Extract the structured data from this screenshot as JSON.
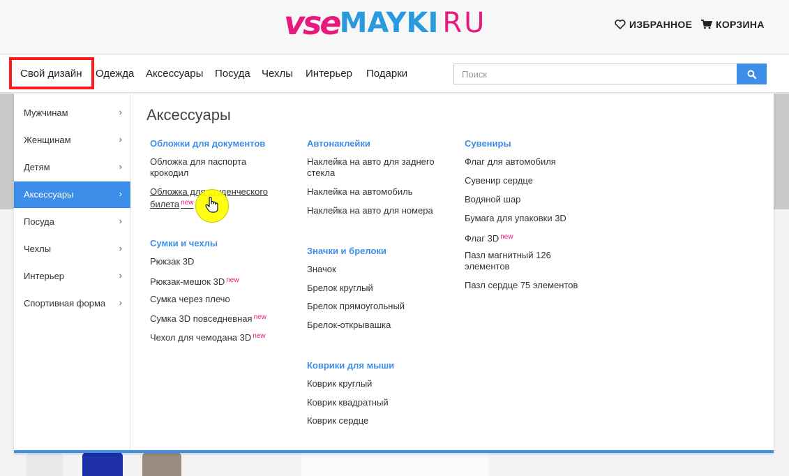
{
  "header": {
    "logo": {
      "part1": "vse",
      "part2": "MAYKI",
      "part3": "RU"
    },
    "favorites_label": "ИЗБРАННОЕ",
    "cart_label": "КОРЗИНА"
  },
  "nav": {
    "items": [
      "Свой дизайн",
      "Одежда",
      "Аксессуары",
      "Посуда",
      "Чехлы",
      "Интерьер",
      "Подарки"
    ],
    "search_placeholder": "Поиск"
  },
  "sidebar": {
    "items": [
      "Мужчинам",
      "Женщинам",
      "Детям",
      "Аксессуары",
      "Посуда",
      "Чехлы",
      "Интерьер",
      "Спортивная форма"
    ],
    "active": "Аксессуары"
  },
  "panel": {
    "title": "Аксессуары",
    "new_label": "new",
    "columns": [
      {
        "groups": [
          {
            "title": "Обложки для документов",
            "links": [
              "Обложка для паспорта крокодил",
              "Обложка для студенческого билета"
            ]
          },
          {
            "title": "Сумки и чехлы",
            "links": [
              "Рюкзак 3D",
              "Рюкзак-мешок 3D",
              "Сумка через плечо",
              "Сумка 3D повседневная",
              "Чехол для чемодана 3D"
            ]
          }
        ]
      },
      {
        "groups": [
          {
            "title": "Автонаклейки",
            "links": [
              "Наклейка на авто для заднего стекла",
              "Наклейка на автомобиль",
              "Наклейка на авто для номера"
            ]
          },
          {
            "title": "Значки и брелоки",
            "links": [
              "Значок",
              "Брелок круглый",
              "Брелок прямоугольный",
              "Брелок-открывашка"
            ]
          },
          {
            "title": "Коврики для мыши",
            "links": [
              "Коврик круглый",
              "Коврик квадратный",
              "Коврик сердце"
            ]
          }
        ]
      },
      {
        "groups": [
          {
            "title": "Сувениры",
            "links": [
              "Флаг для автомобиля",
              "Сувенир сердце",
              "Водяной шар",
              "Бумага для упаковки 3D",
              "Флаг 3D",
              "Пазл магнитный 126 элементов",
              "Пазл сердце 75 элементов"
            ]
          }
        ]
      }
    ]
  },
  "colors": {
    "brand_pink": "#e6197c",
    "brand_blue": "#2a9ae0",
    "accent": "#3c8ee8",
    "highlight": "#ff1a1a"
  }
}
